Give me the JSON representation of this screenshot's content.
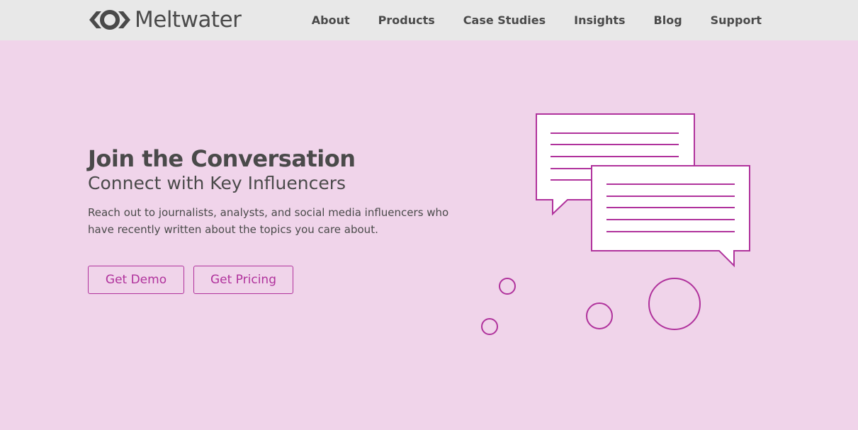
{
  "nav": {
    "brand": "Meltwater",
    "links": [
      "About",
      "Products",
      "Case Studies",
      "Insights",
      "Blog",
      "Support"
    ]
  },
  "hero": {
    "title": "Join the Conversation",
    "subtitle": "Connect with Key Influencers",
    "description": "Reach out to journalists, analysts, and social media influencers who have recently written about the topics you care about."
  },
  "buttons": {
    "demo": "Get Demo",
    "pricing": "Get Pricing"
  },
  "colors": {
    "background": "#f0d4ea",
    "nav_background": "#e8e8e8",
    "accent": "#b0329c",
    "text": "#4a4a4a"
  }
}
